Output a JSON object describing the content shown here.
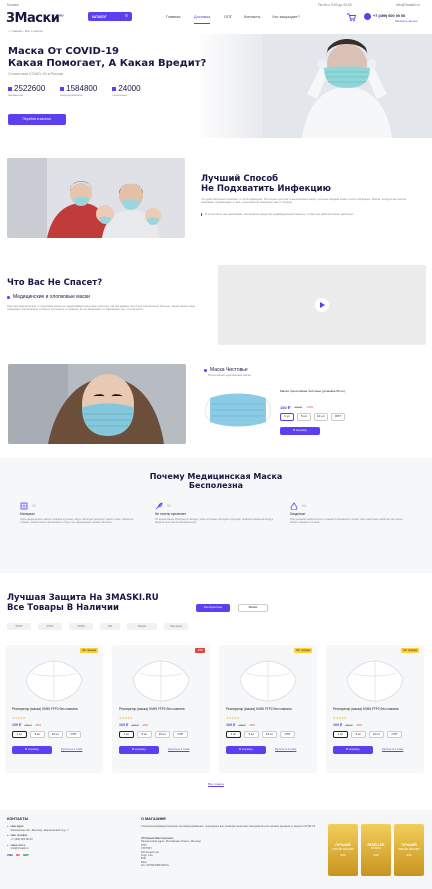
{
  "topbar": {
    "city": "Москва",
    "hours": "Пн-Вс с 9:00 до 20:00",
    "email": "info@3maski.ru"
  },
  "header": {
    "logo": "3Маски",
    "logo_sub": "RU",
    "catalog_label": "КАТАЛОГ",
    "nav": [
      "Главная",
      "Доставка",
      "ОПТ",
      "Контакты",
      "Что защищает?"
    ],
    "phone": "+7 (499) 600 00 00",
    "callback": "Заказать звонок"
  },
  "breadcrumb": [
    "Главная",
    "Всё о масках"
  ],
  "hero": {
    "title": "Маска От COVID-19\nКакая Помогает, А Какая Вредит?",
    "subtitle": "Статистика COVID-19 в России",
    "stats": [
      {
        "num": "2522600",
        "label": "заражения"
      },
      {
        "num": "1584800",
        "label": "выздоровевших"
      },
      {
        "num": "24000",
        "label": "летальных"
      }
    ],
    "cta": "Перейти в каталог"
  },
  "family": {
    "title": "Лучший Способ\nНе Подхватить Инфекцию",
    "text1": "Что действительно помогает от этой инфекции. Это очень простые и выполнимые меры, которые каждый может легко соблюдать. Маска, которую вы носите, защищает окружающих от вас, а респиратор защищает вас от вируса.",
    "text2": "В этой статье мы расскажем, как выбрать средство индивидуальной защиты, чтобы оно действительно работало."
  },
  "who": {
    "title": "Что Вас Не Спасет?",
    "subtitle": "Медицинские и хлопковые маски",
    "text": "Простые медицинские и хлопковые маски не задерживают вирусные частицы, так как размер пор в них значительно больше. Такие маски лишь защищают окружающих от брызг при кашле и чихании, но не защищают от заражения того, кто её носит."
  },
  "product": {
    "tag": "Маска Чистовье",
    "tag_sub": "Трёхслойная одноразовая маска",
    "name": "Маска трехслойная Чистовье (упаковка 50 шт)",
    "price": "180 ₽",
    "old_price": "200 ₽",
    "discount": "-10%",
    "qty": [
      "1 уп",
      "5 шт",
      "10 шт",
      "ОПТ"
    ],
    "cart": "В корзину"
  },
  "why": {
    "title": "Почему Медицинская Маска\nБесполезна",
    "items": [
      {
        "num": "01",
        "title": "Материал",
        "text": "Поры медицинских масок слишком крупные, вирус свободно проходит сквозь ткань. Маска не создаёт герметичного прилегания к лицу и не задерживает мелкие частицы."
      },
      {
        "num": "02",
        "title": "Не плотно прилегает",
        "text": "По краям маски образуются зазоры, через которые при вдохе проходит нефильтрованный воздух. Защита получается минимальной."
      },
      {
        "num": "03",
        "title": "Конденсат",
        "text": "При дыхании маска быстро становится влажной и теряет свои защитные свойства. Её нужно менять каждые 2-3 часа."
      }
    ]
  },
  "catalog": {
    "title": "Лучшая Защита На 3MASKI.RU\nВсе Товары В Наличии",
    "tab_active": "Респираторы",
    "tab2": "Маски",
    "filters": [
      "FFP2",
      "FFP3",
      "KN95",
      "3M",
      "Маски",
      "Перчатки"
    ],
    "more": "Все товары",
    "cards": [
      {
        "badge": "Хит продаж",
        "name": "Респиратор (маска) KN95 FFP2 без клапана",
        "price": "169 ₽",
        "old": "199 ₽",
        "disc": "-15%",
        "qty": [
          "1 шт",
          "5 шт",
          "10 шт",
          "ОПТ"
        ],
        "cart": "В корзину",
        "oneclick": "Купить в 1 клик"
      },
      {
        "badge": "-15%",
        "name": "Респиратор (маска) KN95 FFP2 без клапана",
        "price": "169 ₽",
        "old": "199 ₽",
        "disc": "-15%",
        "qty": [
          "1 шт",
          "5 шт",
          "10 шт",
          "ОПТ"
        ],
        "cart": "В корзину",
        "oneclick": "Купить в 1 клик"
      },
      {
        "badge": "Хит продаж",
        "name": "Респиратор (маска) KN95 FFP2 без клапана",
        "price": "169 ₽",
        "old": "199 ₽",
        "disc": "-15%",
        "qty": [
          "1 шт",
          "5 шт",
          "10 шт",
          "ОПТ"
        ],
        "cart": "В корзину",
        "oneclick": "Купить в 1 клик"
      },
      {
        "badge": "Хит продаж",
        "name": "Респиратор (маска) KN95 FFP2 без клапана",
        "price": "169 ₽",
        "old": "199 ₽",
        "disc": "-15%",
        "qty": [
          "1 шт",
          "5 шт",
          "10 шт",
          "ОПТ"
        ],
        "cart": "В корзину",
        "oneclick": "Купить в 1 клик"
      }
    ]
  },
  "footer": {
    "contacts_title": "КОНТАКТЫ",
    "address_label": "Наш адрес",
    "address": "Московская обл., Мытищи, Шараповский пр-д, 7",
    "phone_label": "Наш телефон",
    "phone": "+7 (499) 600 00 00",
    "email_label": "Наша почта",
    "email": "info@3maski.ru",
    "about_title": "О МАГАЗИНЕ",
    "about_text": "Специализированный магазин сертифицированных, прошедших все проверки защитных материалов для органов дыхания от вируса COVID-19",
    "legal": [
      "ИП Коржев Иван Сергеевич",
      "Юридический адрес: Московская область, Мытищи",
      "ИНН",
      "ОГРНИП",
      "Расчётный счёт",
      "Корр. счёт",
      "БИК",
      "Банк",
      "АО «ТИНЬКОФФ БАНК»"
    ],
    "awards": [
      {
        "t": "ЛУЧШИЙ",
        "s": "ОНЛАЙН МАГАЗИН",
        "y": "2020"
      },
      {
        "t": "RESELLER",
        "s": "RUSSIA",
        "y": "2020"
      },
      {
        "t": "ЛУЧШИЙ",
        "s": "ОНЛАЙН МАГАЗИН",
        "y": "2020"
      }
    ],
    "pay": [
      "VISA",
      "MC",
      "МИР"
    ]
  }
}
